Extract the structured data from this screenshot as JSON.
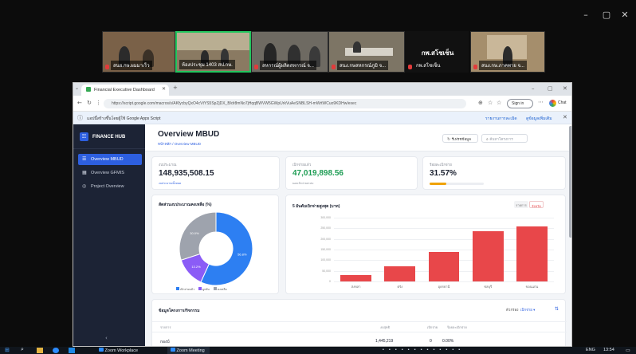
{
  "zoom": {
    "participants": [
      {
        "name": "สนย.กษ.ผมมาเร็ว"
      },
      {
        "name": "ห้องประชุม 1403 สป.กษ."
      },
      {
        "name": "สหกรณ์ผู้ผลิตสหกรณ์ จ..."
      },
      {
        "name": "สนง.กษสหกรณ์ภูมิ จ..."
      },
      {
        "name": "กพ.สโซเซ็น"
      },
      {
        "name": "สนง.กษ.ภาคพาย จ..."
      }
    ],
    "speaker_label": "กพ.สโซเซ็น",
    "window_controls": [
      "–",
      "▢",
      "✕"
    ]
  },
  "browser": {
    "tab_title": "Financial Executive Dashboard",
    "url": "https://script.google.com/macros/s/AKfycbyQxO4cVtYS5SpZjDX_B/dr8mNo7jHqqBWVW5GWpUrkVuAeSNBLSH-mWrtWCuo9KDHw/exec",
    "signin_label": "Sign in",
    "chat_label": "Chat",
    "info_text": "แอปนี้สร้างขึ้นโดยผู้ใช้ Google Apps Script",
    "info_links": [
      "รายงานการละเมิด",
      "ดูข้อมูลเพิ่มเติม"
    ]
  },
  "app": {
    "brand": "FINANCE HUB",
    "nav": [
      {
        "label": "Overview MBUD"
      },
      {
        "label": "Overview GFMIS"
      },
      {
        "label": "Project Overview"
      }
    ],
    "page_title": "Overview MBUD",
    "breadcrumb": "หน้าหลัก / Overview MBUD",
    "refresh_label": "รีเฟรชข้อมูล",
    "search_placeholder": "ค้นหาโครงการ",
    "kpis": [
      {
        "label": "งบประมาณ",
        "value": "148,935,508.15",
        "sub": "งบประมาณทั้งหมด",
        "color": "#1b2130"
      },
      {
        "label": "เบิกจ่ายแล้ว",
        "value": "47,019,898.56",
        "sub": "ยอดเบิกจ่ายสะสม",
        "color": "#1f9d55"
      },
      {
        "label": "ร้อยละเบิกจ่าย",
        "value": "31.57%",
        "progress": 31.57,
        "color": "#1b2130"
      }
    ],
    "donut": {
      "title": "สัดส่วนงบประมาณคงเหลือ (%)",
      "slices": [
        {
          "label": "เบิกจ่ายแล้ว",
          "value": 56.8,
          "color": "#2d7ff2"
        },
        {
          "label": "ผูกพัน",
          "value": 13.2,
          "color": "#8b5cf6"
        },
        {
          "label": "คงเหลือ",
          "value": 30.0,
          "color": "#9ea3ad"
        }
      ],
      "slice_labels": [
        "56.8%",
        "13.2%",
        "30.0%"
      ]
    },
    "bar_chart": {
      "title": "5 อันดับเบิกจ่ายสูงสุด (บาท)",
      "toggle": [
        "รายการ",
        "จังหวัด"
      ]
    },
    "table": {
      "title": "ข้อมูลโครงการ/กิจกรรม",
      "filter_label": "ตัวกรอง",
      "columns": [
        "รายการ",
        "งบสุทธิ",
        "เบิกจ่าย",
        "ร้อยละเบิกจ่าย"
      ],
      "row": {
        "name": "กองบ์",
        "budget": "1,445,219",
        "disbursed": "0",
        "pct": "0.00%"
      }
    }
  },
  "chart_data": {
    "type": "bar",
    "title": "5 อันดับเบิกจ่ายสูงสุด (บาท)",
    "categories": [
      "สงขลา",
      "ตรัง",
      "อุดรธานี",
      "ชลบุรี",
      "ขอนแก่น"
    ],
    "values": [
      3000000,
      7200000,
      13800000,
      23500000,
      26000000
    ],
    "y_ticks": [
      "300,000",
      "250,000",
      "200,000",
      "150,000",
      "100,000",
      "50,000",
      "0"
    ],
    "ylim": [
      0,
      30000000
    ],
    "color": "#e8474a",
    "grid": true
  },
  "taskbar": {
    "apps": [
      "Zoom Workplace",
      "Zoom Meeting"
    ],
    "time": "13:54",
    "lang": "ENG"
  }
}
